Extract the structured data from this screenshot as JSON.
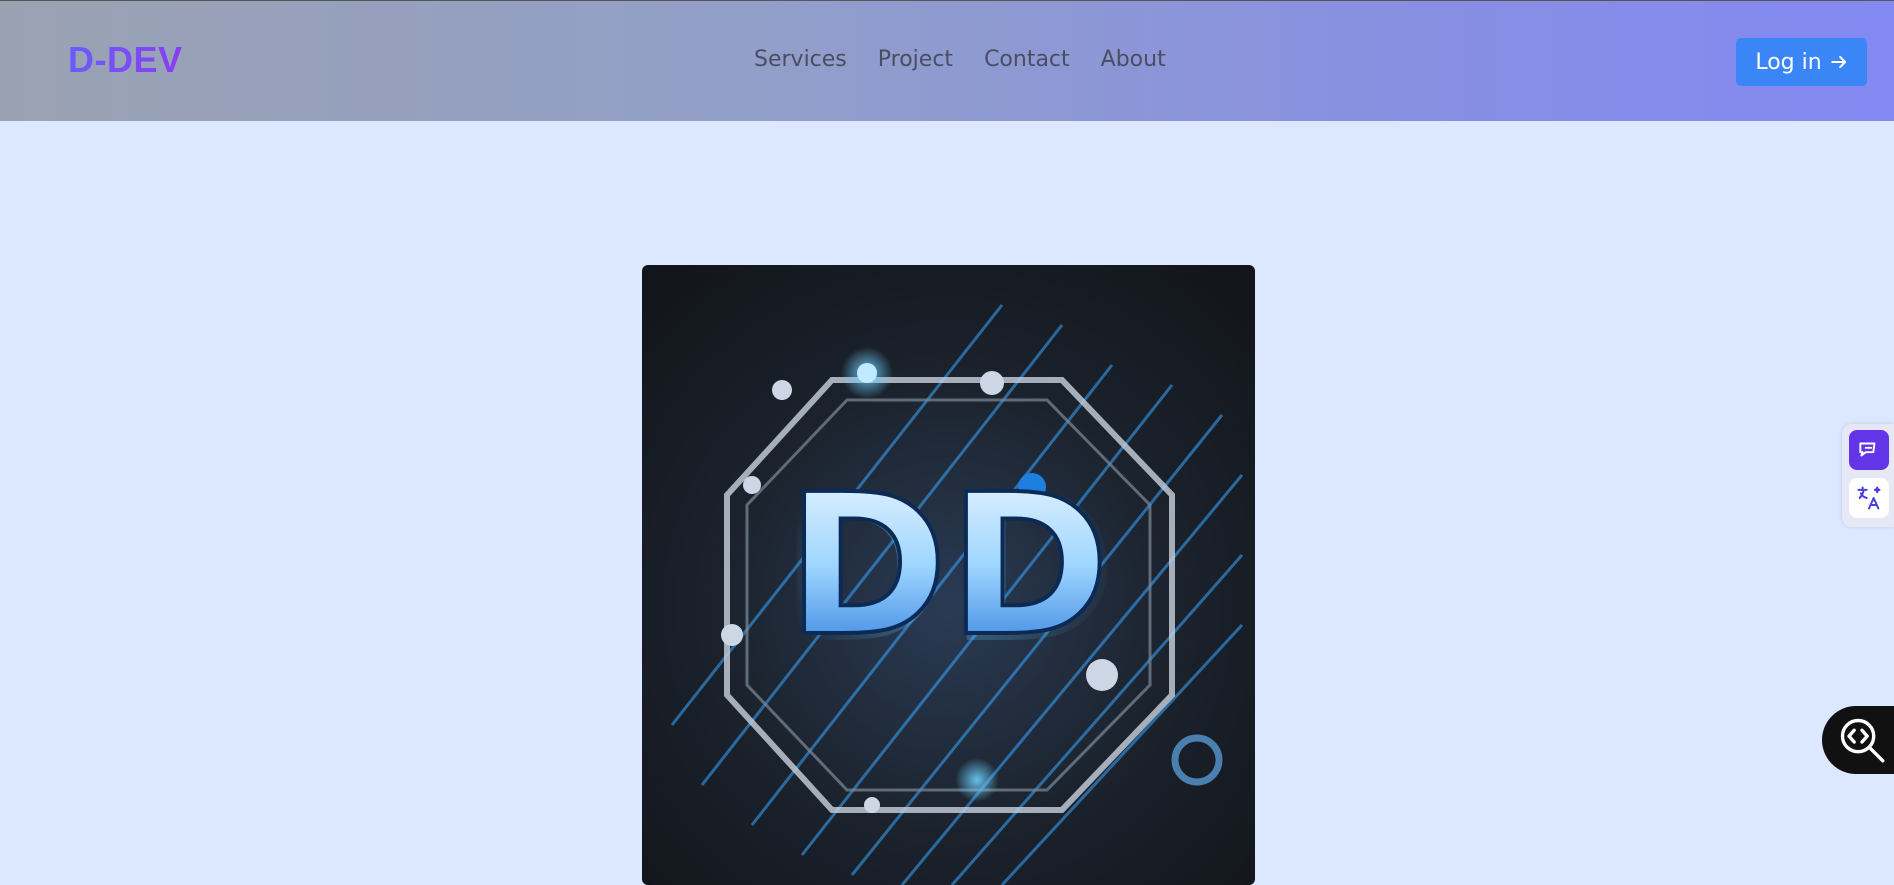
{
  "header": {
    "brand": "D-DEV",
    "nav": [
      {
        "label": "Services"
      },
      {
        "label": "Project"
      },
      {
        "label": "Contact"
      },
      {
        "label": "About"
      }
    ],
    "login_label": "Log in"
  },
  "hero": {
    "logo_text": "DD"
  },
  "colors": {
    "background": "#dbe8ff",
    "accent": "#3b86f7",
    "brand": "#6a5cff"
  },
  "icons": {
    "login": "arrow-right-icon",
    "chat": "chat-icon",
    "translate": "translate-icon",
    "devtool": "code-search-icon"
  }
}
